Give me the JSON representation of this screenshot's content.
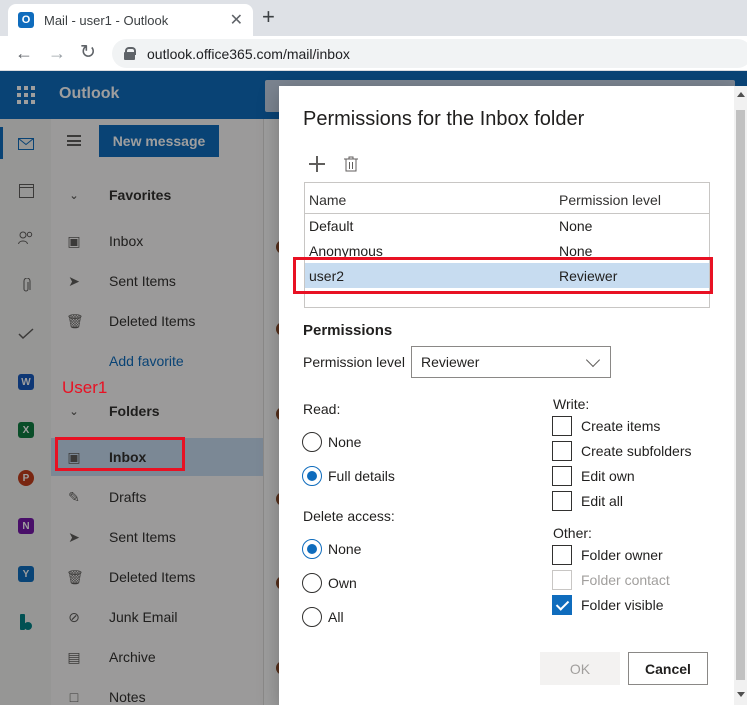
{
  "browser": {
    "tab_title": "Mail - user1 - Outlook",
    "favicon_letter": "O",
    "new_tab": "+",
    "close": "✕",
    "url": "outlook.office365.com/mail/inbox"
  },
  "app": {
    "name": "Outlook"
  },
  "rail": {
    "icons": [
      "mail-icon",
      "calendar-icon",
      "people-icon",
      "attachment-icon",
      "todo-icon",
      "word-icon",
      "excel-icon",
      "powerpoint-icon",
      "onenote-icon",
      "yammer-icon",
      "bookings-icon"
    ],
    "word_letter": "W",
    "excel_letter": "X",
    "powerpoint_letter": "P",
    "onenote_letter": "N",
    "yammer_letter": "Y"
  },
  "folder_pane": {
    "new_message": "New message",
    "favorites_header": "Favorites",
    "favorites": [
      "Inbox",
      "Sent Items",
      "Deleted Items"
    ],
    "add_favorite": "Add favorite",
    "folders_header": "Folders",
    "folders": [
      "Inbox",
      "Drafts",
      "Sent Items",
      "Deleted Items",
      "Junk Email",
      "Archive",
      "Notes"
    ]
  },
  "annotation": {
    "user_label": "User1"
  },
  "dialog": {
    "title": "Permissions for the Inbox folder",
    "table_headers": {
      "name": "Name",
      "level": "Permission level"
    },
    "table_rows": [
      {
        "name": "Default",
        "level": "None"
      },
      {
        "name": "Anonymous",
        "level": "None"
      },
      {
        "name": "user2",
        "level": "Reviewer"
      }
    ],
    "permissions_heading": "Permissions",
    "permission_level_label": "Permission level",
    "permission_level_value": "Reviewer",
    "read_label": "Read:",
    "read_options": [
      {
        "label": "None",
        "checked": false
      },
      {
        "label": "Full details",
        "checked": true
      }
    ],
    "delete_label": "Delete access:",
    "delete_options": [
      {
        "label": "None",
        "checked": true
      },
      {
        "label": "Own",
        "checked": false
      },
      {
        "label": "All",
        "checked": false
      }
    ],
    "write_label": "Write:",
    "write_options": [
      {
        "label": "Create items",
        "checked": false
      },
      {
        "label": "Create subfolders",
        "checked": false
      },
      {
        "label": "Edit own",
        "checked": false
      },
      {
        "label": "Edit all",
        "checked": false
      }
    ],
    "other_label": "Other:",
    "other_options": [
      {
        "label": "Folder owner",
        "checked": false,
        "disabled": false
      },
      {
        "label": "Folder contact",
        "checked": false,
        "disabled": true
      },
      {
        "label": "Folder visible",
        "checked": true,
        "disabled": false
      }
    ],
    "ok": "OK",
    "cancel": "Cancel"
  },
  "colors": {
    "brand": "#0f6cbd",
    "highlight_red": "#e81123",
    "selected_row": "#c7dcf0"
  }
}
